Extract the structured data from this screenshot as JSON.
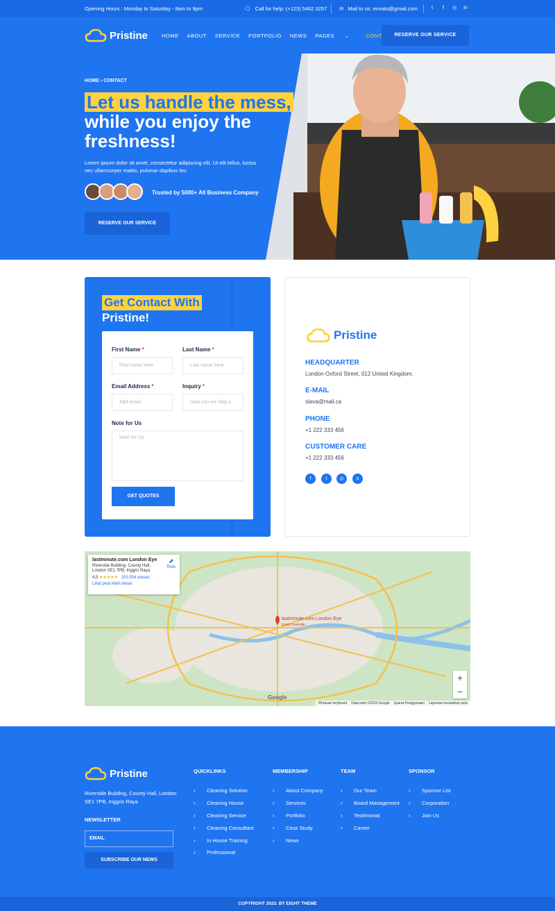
{
  "topbar": {
    "hours": "Opening Hours : Monday to Saturday - 8am to 9pm",
    "call": "Call for help: (+123) 5462 3257",
    "mail": "Mail to us: envato@gmail.com",
    "social": [
      "twitter-icon",
      "facebook-icon",
      "instagram-icon",
      "linkedin-icon"
    ]
  },
  "brand": {
    "name": "Pristine"
  },
  "nav": {
    "items": [
      "HOME",
      "ABOUT",
      "SERVICE",
      "PORTFOLIO",
      "NEWS",
      "PAGES",
      "CONTACT"
    ],
    "pages_chevron": "⌄",
    "cta": "RESERVE OUR SERVICE"
  },
  "hero": {
    "breadcrumb": "HOME › CONTACT",
    "headline_highlight": "Let us handle the mess,",
    "headline_rest": "while you enjoy the freshness!",
    "description": "Lorem ipsum dolor sit amet, consectetur adipiscing elit. Ut elit tellus, luctus nec ullamcorper mattis, pulvinar dapibus leo.",
    "trusted": "Trusted by 5000+ All Business Company",
    "cta": "RESERVE OUR SERVICE"
  },
  "contact_form": {
    "title_highlight": "Get Contact With",
    "title_rest": "Pristine!",
    "first_name_label": "First Name",
    "first_name_placeholder": "First name here",
    "last_name_label": "Last Name",
    "last_name_placeholder": "Last name here",
    "email_label": "Email Address",
    "email_placeholder": "Add email",
    "inquiry_label": "Inquiry",
    "inquiry_placeholder": "How can we help y",
    "note_label": "Note for Us",
    "note_placeholder": "Note for Us",
    "required_mark": "*",
    "submit": "GET QUOTES"
  },
  "info": {
    "headquarter_label": "HEADQUARTER",
    "headquarter_value": "London Oxford Street, 012 United Kingdom.",
    "email_label": "E-MAIL",
    "email_value": "slava@mail.ca",
    "phone_label": "PHONE",
    "phone_value": "+1 222 333 456",
    "care_label": "CUSTOMER CARE",
    "care_value": "+1 222 333 456",
    "social": [
      "facebook-icon",
      "twitter-icon",
      "instagram-icon",
      "skype-icon"
    ]
  },
  "map": {
    "place_title": "lastminute.com London Eye",
    "place_address": "Riverside Building, County Hall, London SE1 7PB, Inggris Raya",
    "rating": "4,5",
    "stars": "★★★★★",
    "reviews": "153.554 ulasan",
    "larger_map": "Lihat peta lebih besar",
    "route": "Rute",
    "pin_label": "lastminute.com London Eye",
    "pin_sub": "Iconic riverside",
    "zoom_in": "+",
    "zoom_out": "−",
    "google": "Google",
    "attribution": [
      "Pintasan keyboard",
      "Data peta ©2023 Google",
      "Syarat Penggunaan",
      "Laporkan kesalahan peta"
    ]
  },
  "footer": {
    "address": "Riverside Building, County Hall, London SE1 7PB, Inggris Raya",
    "newsletter_label": "NEWSLETTER",
    "email_placeholder": "EMAIL",
    "subscribe": "SUBSCRIBE OUR NEWS",
    "quicklinks_title": "QUICKLINKS",
    "quicklinks": [
      "Cleaning Solution",
      "Cleaning House",
      "Cleaning Service",
      "Cleaning Consultant",
      "In House Training",
      "Professional"
    ],
    "membership_title": "MEMBERSHIP",
    "membership": [
      "About Company",
      "Services",
      "Portfolio",
      "Case Study",
      "News"
    ],
    "team_title": "TEAM",
    "team": [
      "Our Team",
      "Board Management",
      "Testimonial",
      "Career"
    ],
    "sponsor_title": "SPONSOR",
    "sponsor": [
      "Sponsor List",
      "Corporation",
      "Join Us"
    ],
    "chevron": "›",
    "copyright": "COPYRIGHT 2023. BY EIGHT THEME"
  },
  "colors": {
    "primary": "#1f74f0",
    "dark_primary": "#1a63d8",
    "accent": "#ffd23f"
  }
}
